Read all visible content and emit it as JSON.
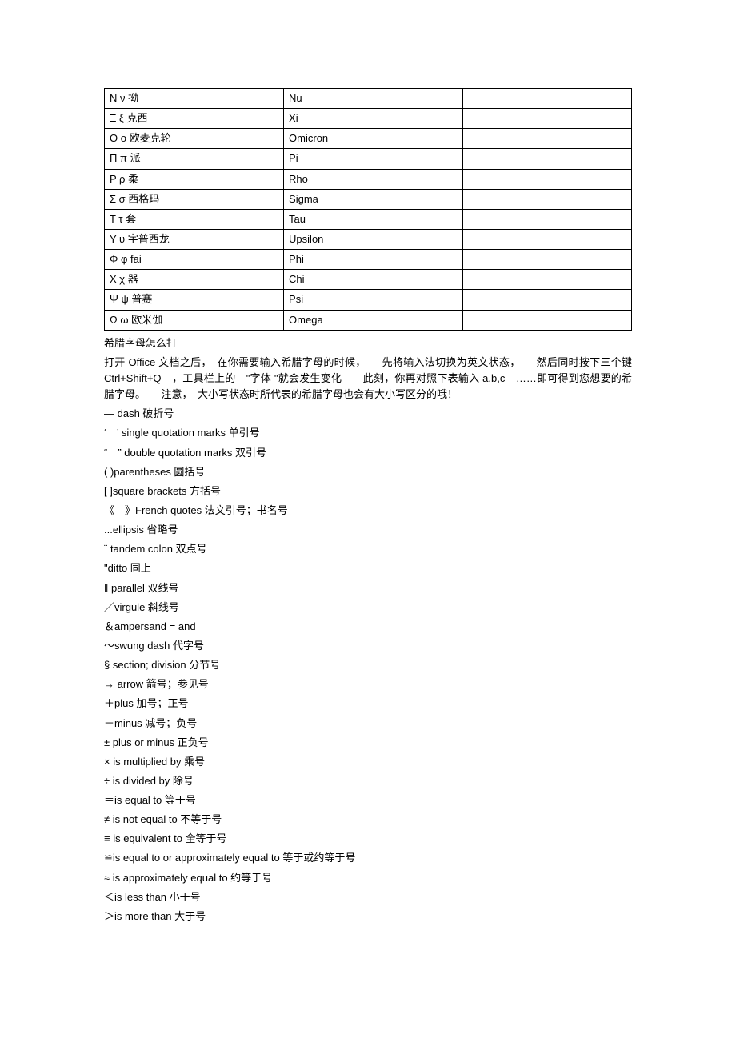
{
  "table": {
    "rows": [
      {
        "c1": "Ν ν 拗",
        "c2": "Nu",
        "c3": ""
      },
      {
        "c1": "Ξ ξ 克西",
        "c2": "Xi",
        "c3": ""
      },
      {
        "c1": "Ο ο 欧麦克轮",
        "c2": "Omicron",
        "c3": ""
      },
      {
        "c1": "Π π 派",
        "c2": "Pi",
        "c3": ""
      },
      {
        "c1": "Ρ ρ 柔",
        "c2": "Rho",
        "c3": ""
      },
      {
        "c1": "Σ σ 西格玛",
        "c2": "Sigma",
        "c3": ""
      },
      {
        "c1": "Τ τ 套",
        "c2": "Tau",
        "c3": ""
      },
      {
        "c1": "Υ υ 宇普西龙",
        "c2": "Upsilon",
        "c3": ""
      },
      {
        "c1": "Φ φ fai",
        "c2": "Phi",
        "c3": ""
      },
      {
        "c1": "Χ χ 器",
        "c2": "Chi",
        "c3": ""
      },
      {
        "c1": "Ψ ψ 普赛",
        "c2": "Psi",
        "c3": ""
      },
      {
        "c1": "Ω ω 欧米伽",
        "c2": "Omega",
        "c3": ""
      }
    ]
  },
  "heading": "希腊字母怎么打",
  "paragraph": "打开 Office 文档之后，　在你需要输入希腊字母的时候，　　先将输入法切换为英文状态，　　然后同时按下三个键　　Ctrl+Shift+Q　，工具栏上的　\"字体 \"就会发生变化　　此刻，你再对照下表输入 a,b,c　……即可得到您想要的希腊字母。　　注意，　大小写状态时所代表的希腊字母也会有大小写区分的哦！",
  "lines": [
    "― dash 破折号",
    "‘　’ single quotation marks 单引号",
    "“　” double quotation marks 双引号",
    "( )parentheses 圆括号",
    "[ ]square brackets  方括号",
    "《　》French quotes  法文引号；书名号",
    "...ellipsis  省略号",
    "¨ tandem colon 双点号",
    "\"ditto  同上",
    "‖ parallel 双线号",
    "／virgule  斜线号",
    "＆ampersand = and",
    "～swung dash 代字号",
    "§ section; division 分节号",
    "→ arrow 箭号；参见号",
    "＋plus  加号；正号",
    "－minus 减号；负号",
    "± plus or minus 正负号",
    "× is multiplied by  乘号",
    "÷ is divided by 除号",
    "＝is equal to  等于号",
    "≠ is not equal to 不等于号",
    "≡ is equivalent to 全等于号",
    "≌is equal to or approximately equal to  等于或约等于号",
    "≈ is approximately equal to  约等于号",
    "＜is less than  小于号",
    "＞is more than  大于号"
  ]
}
